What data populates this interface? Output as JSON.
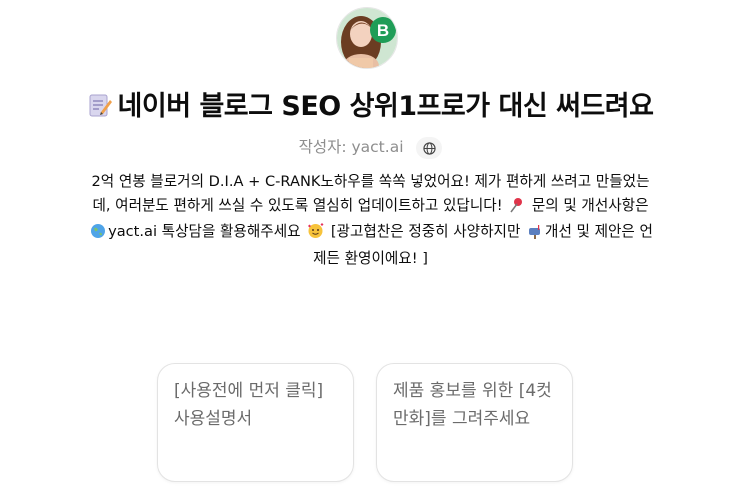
{
  "gpt": {
    "title": "네이버 블로그 SEO 상위1프로가 대신 써드려요",
    "title_emoji": "memo-icon",
    "author_label": "작성자: yact.ai",
    "author_icon": "globe-icon"
  },
  "description": {
    "part1": "2억 연봉 블로거의 D.I.A + C-RANK노하우를 쏙쏙 넣었어요! 제가 편하게 쓰려고 만들었는데, 여러분도 편하게 쓰실 수 있도록 열심히 업데이트하고 있답니다!",
    "part2": "문의 및 개선사항은",
    "part3": "yact.ai 톡상담을 활용해주세요",
    "part4": "[광고협찬은 정중히 사양하지만",
    "part5": "개선 및 제안은 언제든 환영이에요! ]"
  },
  "conversation_starters": [
    {
      "text": "[사용전에 먼저 클릭]사용설명서"
    },
    {
      "text": "제품 홍보를 위한 [4컷만화]를 그려주세요"
    }
  ],
  "colors": {
    "title_text": "#0d0d0d",
    "muted_text": "#8e8e8e",
    "card_border": "#e3e3e3",
    "avatar_badge": "#1f9d57"
  }
}
